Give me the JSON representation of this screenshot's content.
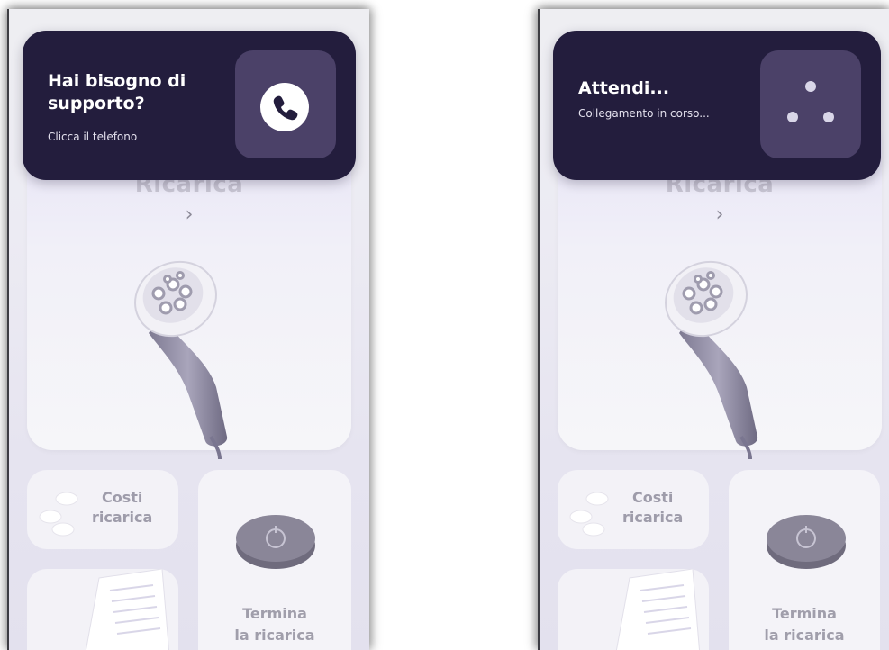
{
  "colors": {
    "banner_bg": "#231d3d",
    "banner_button_bg": "#4b4168",
    "text_on_dark": "#ffffff",
    "muted_card_text": "#9e9caa"
  },
  "left_screen": {
    "banner": {
      "title": "Hai bisogno di supporto?",
      "subtitle": "Clicca il telefono",
      "icon": "phone-icon"
    },
    "main_card": {
      "title_partial": "Ricarica",
      "chevron": "›",
      "image": "charger-plug-icon"
    },
    "costi_card": {
      "line1": "Costi",
      "line2": "ricarica",
      "image": "coins-icon"
    },
    "termina_card": {
      "line1": "Termina",
      "line2": "la ricarica",
      "image": "stop-device-icon"
    },
    "doc_card": {
      "image": "receipt-icon"
    }
  },
  "right_screen": {
    "banner": {
      "title": "Attendi...",
      "subtitle": "Collegamento in corso...",
      "icon": "loading-dots-icon"
    },
    "main_card": {
      "title_partial": "Ricarica",
      "chevron": "›",
      "image": "charger-plug-icon"
    },
    "costi_card": {
      "line1": "Costi",
      "line2": "ricarica",
      "image": "coins-icon"
    },
    "termina_card": {
      "line1": "Termina",
      "line2": "la ricarica",
      "image": "stop-device-icon"
    },
    "doc_card": {
      "image": "receipt-icon"
    }
  }
}
